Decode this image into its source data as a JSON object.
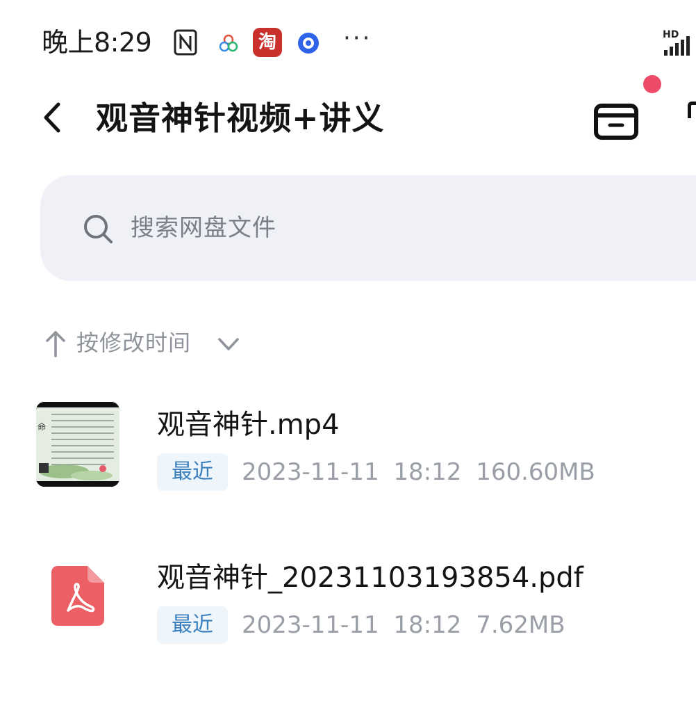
{
  "status_bar": {
    "time": "晚上8:29",
    "taobao_glyph": "淘",
    "more": "···",
    "network": "HD",
    "icons": [
      "nfc-icon",
      "clover-app-icon",
      "taobao-app-icon",
      "blue-circle-app-icon",
      "signal-icon"
    ]
  },
  "header": {
    "title": "观音神针视频+讲义",
    "icons": [
      "back-arrow-icon",
      "archive-box-icon",
      "notification-dot"
    ],
    "accent_color": "#ee4a6a"
  },
  "search": {
    "placeholder": "搜索网盘文件",
    "icon": "search-icon"
  },
  "sort": {
    "label": "按修改时间",
    "icons": [
      "arrow-up-icon",
      "chevron-down-icon"
    ]
  },
  "files": [
    {
      "name": "观音神针.mp4",
      "badge": "最近",
      "date": "2023-11-11",
      "time": "18:12",
      "size": "160.60MB",
      "icon": "video-thumbnail"
    },
    {
      "name": "观音神针_20231103193854.pdf",
      "badge": "最近",
      "date": "2023-11-11",
      "time": "18:12",
      "size": "7.62MB",
      "icon": "pdf-icon",
      "icon_color": "#ec5f65"
    }
  ],
  "colors": {
    "search_bg": "#eff1f6",
    "badge_bg": "#eef5fb",
    "badge_text": "#3a7fbd",
    "meta_text": "#9a9ea6"
  }
}
